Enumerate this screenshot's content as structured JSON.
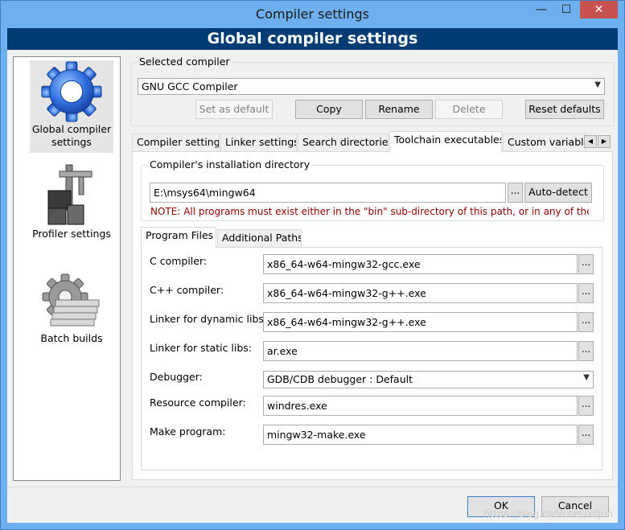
{
  "window": {
    "title": "Compiler settings",
    "min_glyph": "—",
    "max_glyph": "☐",
    "close_glyph": "✕"
  },
  "banner": {
    "title": "Global compiler settings"
  },
  "sidebar": {
    "items": [
      {
        "label": "Global compiler settings",
        "icon": "gear-icon",
        "selected": true
      },
      {
        "label": "Profiler settings",
        "icon": "caliper-icon",
        "selected": false
      },
      {
        "label": "Batch builds",
        "icon": "batch-gear-icon",
        "selected": false
      }
    ]
  },
  "selected_compiler": {
    "group_title": "Selected compiler",
    "value": "GNU GCC Compiler",
    "buttons": {
      "set_default": "Set as default",
      "copy": "Copy",
      "rename": "Rename",
      "delete": "Delete",
      "reset": "Reset defaults"
    }
  },
  "tabs": [
    {
      "label": "Compiler settings"
    },
    {
      "label": "Linker settings"
    },
    {
      "label": "Search directories"
    },
    {
      "label": "Toolchain executables",
      "active": true
    },
    {
      "label": "Custom variable"
    }
  ],
  "install_dir": {
    "group_title": "Compiler's installation directory",
    "value": "E:\\msys64\\mingw64",
    "browse_label": "...",
    "autodetect_label": "Auto-detect",
    "note": "NOTE: All programs must exist either in the \"bin\" sub-directory of this path, or in any of the"
  },
  "subtabs": [
    {
      "label": "Program Files",
      "active": true
    },
    {
      "label": "Additional Paths"
    }
  ],
  "programs": [
    {
      "label": "C compiler:",
      "value": "x86_64-w64-mingw32-gcc.exe",
      "type": "text"
    },
    {
      "label": "C++ compiler:",
      "value": "x86_64-w64-mingw32-g++.exe",
      "type": "text"
    },
    {
      "label": "Linker for dynamic libs:",
      "value": "x86_64-w64-mingw32-g++.exe",
      "type": "text"
    },
    {
      "label": "Linker for static libs:",
      "value": "ar.exe",
      "type": "text"
    },
    {
      "label": "Debugger:",
      "value": "GDB/CDB debugger : Default",
      "type": "combo"
    },
    {
      "label": "Resource compiler:",
      "value": "windres.exe",
      "type": "text"
    },
    {
      "label": "Make program:",
      "value": "mingw32-make.exe",
      "type": "text"
    }
  ],
  "browse_label": "...",
  "footer": {
    "ok": "OK",
    "cancel": "Cancel"
  },
  "watermark": "https://blog.csdn.net/xiljun",
  "colors": {
    "title_bar": "#6eb0ef",
    "banner": "#003c74",
    "close": "#c7514e",
    "note": "#8b0000"
  }
}
